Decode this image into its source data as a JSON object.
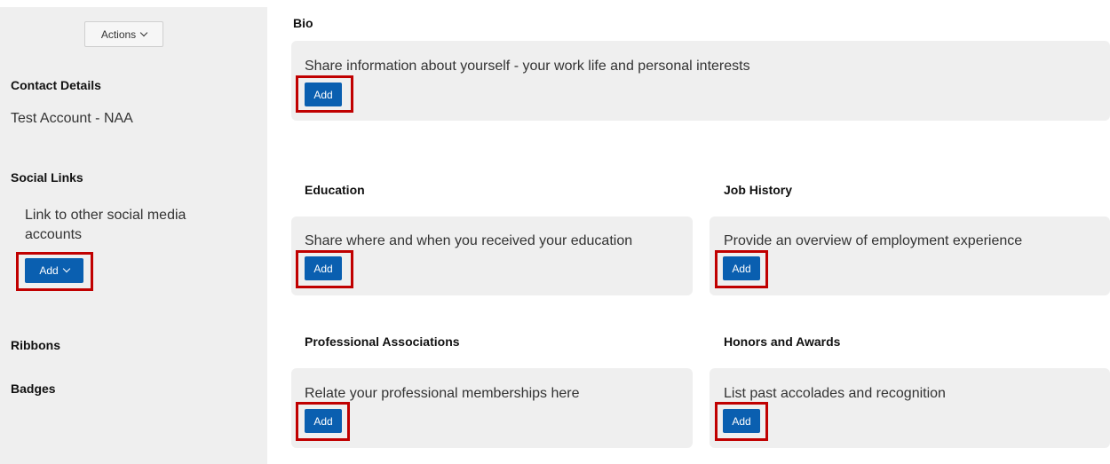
{
  "sidebar": {
    "actions_label": "Actions",
    "contact_heading": "Contact Details",
    "contact_name": "Test Account - NAA",
    "social_heading": "Social Links",
    "social_text": "Link to other social media accounts",
    "social_add_label": "Add",
    "ribbons_heading": "Ribbons",
    "badges_heading": "Badges"
  },
  "bio": {
    "heading": "Bio",
    "text": "Share information about yourself - your work life and personal interests",
    "add_label": "Add"
  },
  "education": {
    "heading": "Education",
    "text": "Share where and when you received your education",
    "add_label": "Add"
  },
  "job_history": {
    "heading": "Job History",
    "text": "Provide an overview of employment experience",
    "add_label": "Add"
  },
  "associations": {
    "heading": "Professional Associations",
    "text": "Relate your professional memberships here",
    "add_label": "Add"
  },
  "honors": {
    "heading": "Honors and Awards",
    "text": "List past accolades and recognition",
    "add_label": "Add"
  },
  "colors": {
    "accent": "#0a5fb0",
    "highlight": "#c00000",
    "panel": "#efefef"
  }
}
